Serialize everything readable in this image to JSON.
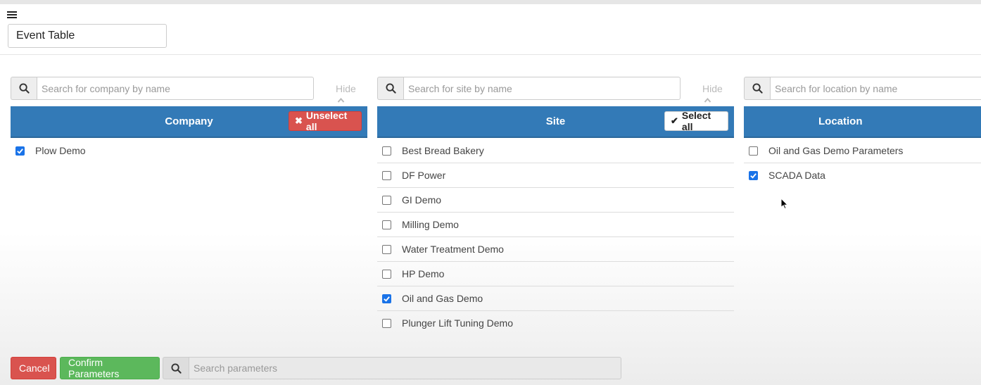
{
  "report_title": "Event Table",
  "company": {
    "search_placeholder": "Search for company by name",
    "hide_label": "Hide",
    "header": "Company",
    "button_label": "Unselect all",
    "items": [
      {
        "label": "Plow Demo",
        "checked": true
      }
    ]
  },
  "site": {
    "search_placeholder": "Search for site by name",
    "hide_label": "Hide",
    "header": "Site",
    "button_label": "Select all",
    "items": [
      {
        "label": "Best Bread Bakery",
        "checked": false
      },
      {
        "label": "DF Power",
        "checked": false
      },
      {
        "label": "GI Demo",
        "checked": false
      },
      {
        "label": "Milling Demo",
        "checked": false
      },
      {
        "label": "Water Treatment Demo",
        "checked": false
      },
      {
        "label": "HP Demo",
        "checked": false
      },
      {
        "label": "Oil and Gas Demo",
        "checked": true
      },
      {
        "label": "Plunger Lift Tuning Demo",
        "checked": false
      }
    ]
  },
  "location": {
    "search_placeholder": "Search for location by name",
    "header": "Location",
    "items": [
      {
        "label": "Oil and Gas Demo Parameters",
        "checked": false
      },
      {
        "label": "SCADA Data",
        "checked": true
      }
    ]
  },
  "footer": {
    "cancel_label": "Cancel",
    "confirm_label": "Confirm Parameters",
    "search_placeholder": "Search parameters"
  },
  "colors": {
    "header_blue": "#337ab7",
    "cancel_red": "#d9534f",
    "confirm_green": "#5cb85c",
    "checkbox_blue": "#1a73e8"
  }
}
